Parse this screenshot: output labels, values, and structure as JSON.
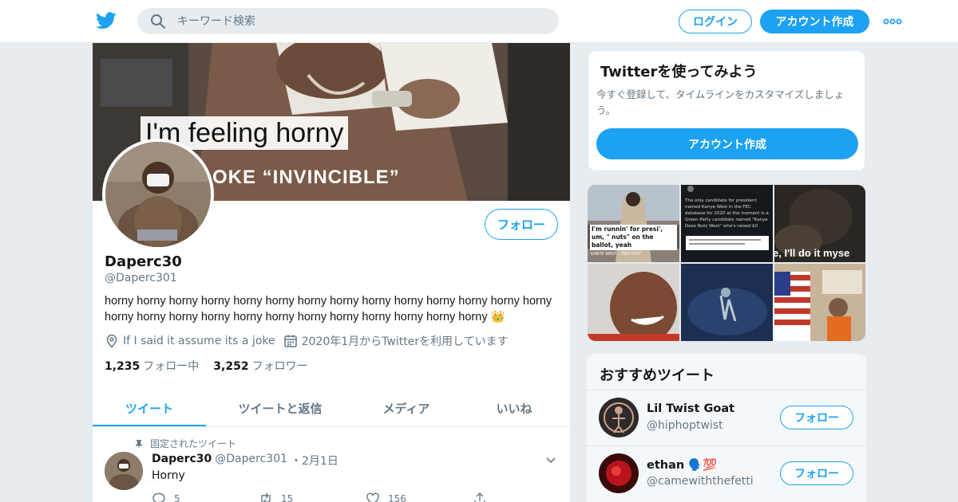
{
  "header": {
    "search_placeholder": "キーワード検索",
    "login_label": "ログイン",
    "signup_label": "アカウント作成"
  },
  "profile": {
    "banner_caption": "I'm feeling horny",
    "banner_caption2": "OKE “INVINCIBLE”",
    "follow_label": "フォロー",
    "display_name": "Daperc30",
    "screen_name": "@Daperc301",
    "bio": "horny horny horny horny horny horny horny horny horny horny horny horny horny horny horny horny horny horny horny horny horny horny horny horny horny horny 👑",
    "location": "If I said it assume its a joke",
    "joined": "2020年1月からTwitterを利用しています",
    "following_count": "1,235",
    "following_label": "フォロー中",
    "followers_count": "3,252",
    "followers_label": "フォロワー"
  },
  "tabs": [
    {
      "label": "ツイート"
    },
    {
      "label": "ツイートと返信"
    },
    {
      "label": "メディア"
    },
    {
      "label": "いいね"
    }
  ],
  "pinned_tweet": {
    "pinned_label": "固定されたツイート",
    "name": "Daperc30",
    "screen_name": "@Daperc301",
    "date": "・2月1日",
    "text": "Horny",
    "replies": "5",
    "retweets": "15",
    "likes": "156"
  },
  "signup_card": {
    "title": "Twitterを使ってみよう",
    "description": "今すぐ登録して、タイムラインをカスタマイズしましょう。",
    "button_label": "アカウント作成"
  },
  "media": {
    "tile1_caption": "I'm runnin' for presi', um, \" nuts\" on the ballot, yeah",
    "tile1_sub": "KANYE WEST - \"SKY CITY\"",
    "tile2_text": "The only candidate for president named Kanye West in the FEC database for 2020 at the moment is a Green Party candidate named \"Kanye Deez Nutz West\" who's raised $0",
    "tile3_caption": "e, I'll do it myse"
  },
  "suggestions": {
    "title": "おすすめツイート",
    "users": [
      {
        "name": "Lil Twist Goat",
        "screen_name": "@hiphoptwist",
        "follow_label": "フォロー"
      },
      {
        "name": "ethan 🗣️💯",
        "screen_name": "@camewiththefetti",
        "follow_label": "フォロー"
      }
    ]
  },
  "colors": {
    "accent": "#1da1f2",
    "background": "#e6ecf0",
    "secondary_text": "#657786"
  },
  "icons": [
    "twitter-logo-icon",
    "search-icon",
    "more-dots-icon",
    "location-pin-icon",
    "calendar-icon",
    "pin-icon",
    "chevron-down-icon",
    "reply-icon",
    "retweet-icon",
    "like-icon",
    "share-icon"
  ]
}
